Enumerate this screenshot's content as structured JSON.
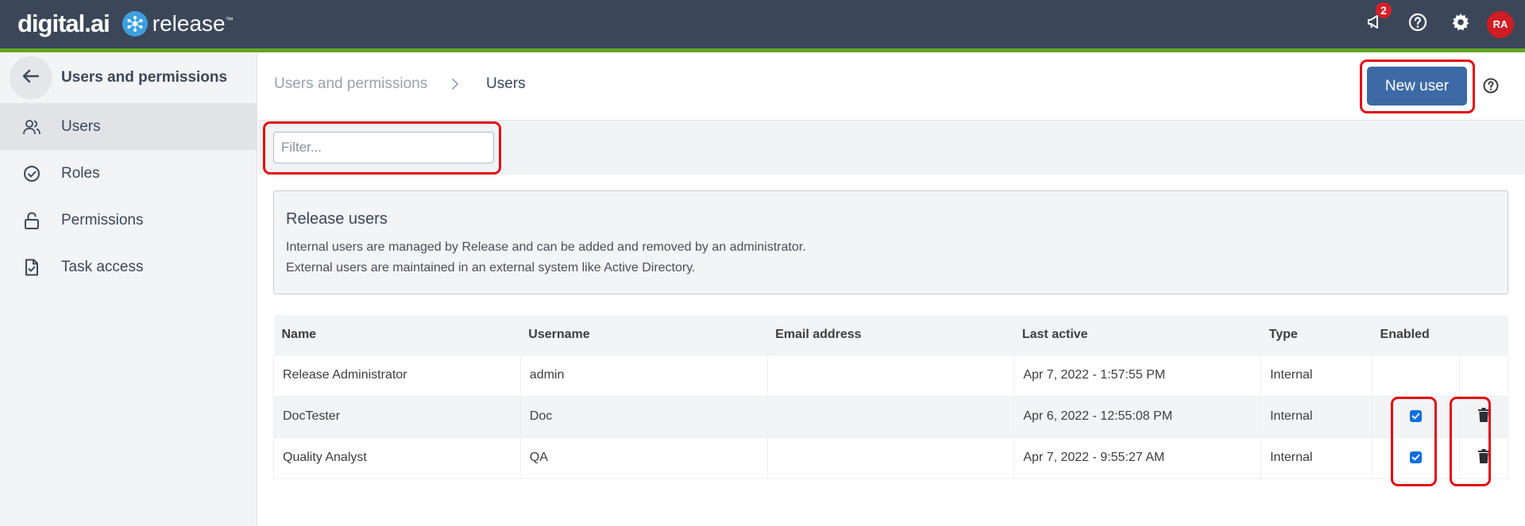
{
  "brand": {
    "digital": "digital.ai",
    "product": "release",
    "tm": "™"
  },
  "topbar": {
    "notifications_count": "2",
    "avatar_initials": "RA",
    "icons": [
      "megaphone-icon",
      "help-circle-icon",
      "gear-icon"
    ]
  },
  "sidebar": {
    "title": "Users and permissions",
    "items": [
      {
        "label": "Users",
        "icon": "users-icon",
        "active": true
      },
      {
        "label": "Roles",
        "icon": "check-circle-icon",
        "active": false
      },
      {
        "label": "Permissions",
        "icon": "unlock-icon",
        "active": false
      },
      {
        "label": "Task access",
        "icon": "task-file-icon",
        "active": false
      }
    ]
  },
  "breadcrumb": {
    "parent": "Users and permissions",
    "separator": ">",
    "current": "Users"
  },
  "header": {
    "new_user_label": "New user"
  },
  "filter": {
    "placeholder": "Filter...",
    "value": ""
  },
  "info": {
    "title": "Release users",
    "line1": "Internal users are managed by Release and can be added and removed by an administrator.",
    "line2": "External users are maintained in an external system like Active Directory."
  },
  "table": {
    "columns": [
      "Name",
      "Username",
      "Email address",
      "Last active",
      "Type",
      "Enabled",
      ""
    ],
    "rows": [
      {
        "name": "Release Administrator",
        "username": "admin",
        "email": "",
        "last_active": "Apr 7, 2022 - 1:57:55 PM",
        "type": "Internal",
        "enabled": null,
        "deletable": false
      },
      {
        "name": "DocTester",
        "username": "Doc",
        "email": "",
        "last_active": "Apr 6, 2022 - 12:55:08 PM",
        "type": "Internal",
        "enabled": true,
        "deletable": true
      },
      {
        "name": "Quality Analyst",
        "username": "QA",
        "email": "",
        "last_active": "Apr 7, 2022 - 9:55:27 AM",
        "type": "Internal",
        "enabled": true,
        "deletable": true
      }
    ]
  },
  "colors": {
    "topbar": "#3b4759",
    "accent_green": "#63a524",
    "primary_button": "#3d6aa5",
    "highlight_red": "#e20b14",
    "badge_red": "#d61f26",
    "checkbox_blue": "#0f6fe0"
  }
}
